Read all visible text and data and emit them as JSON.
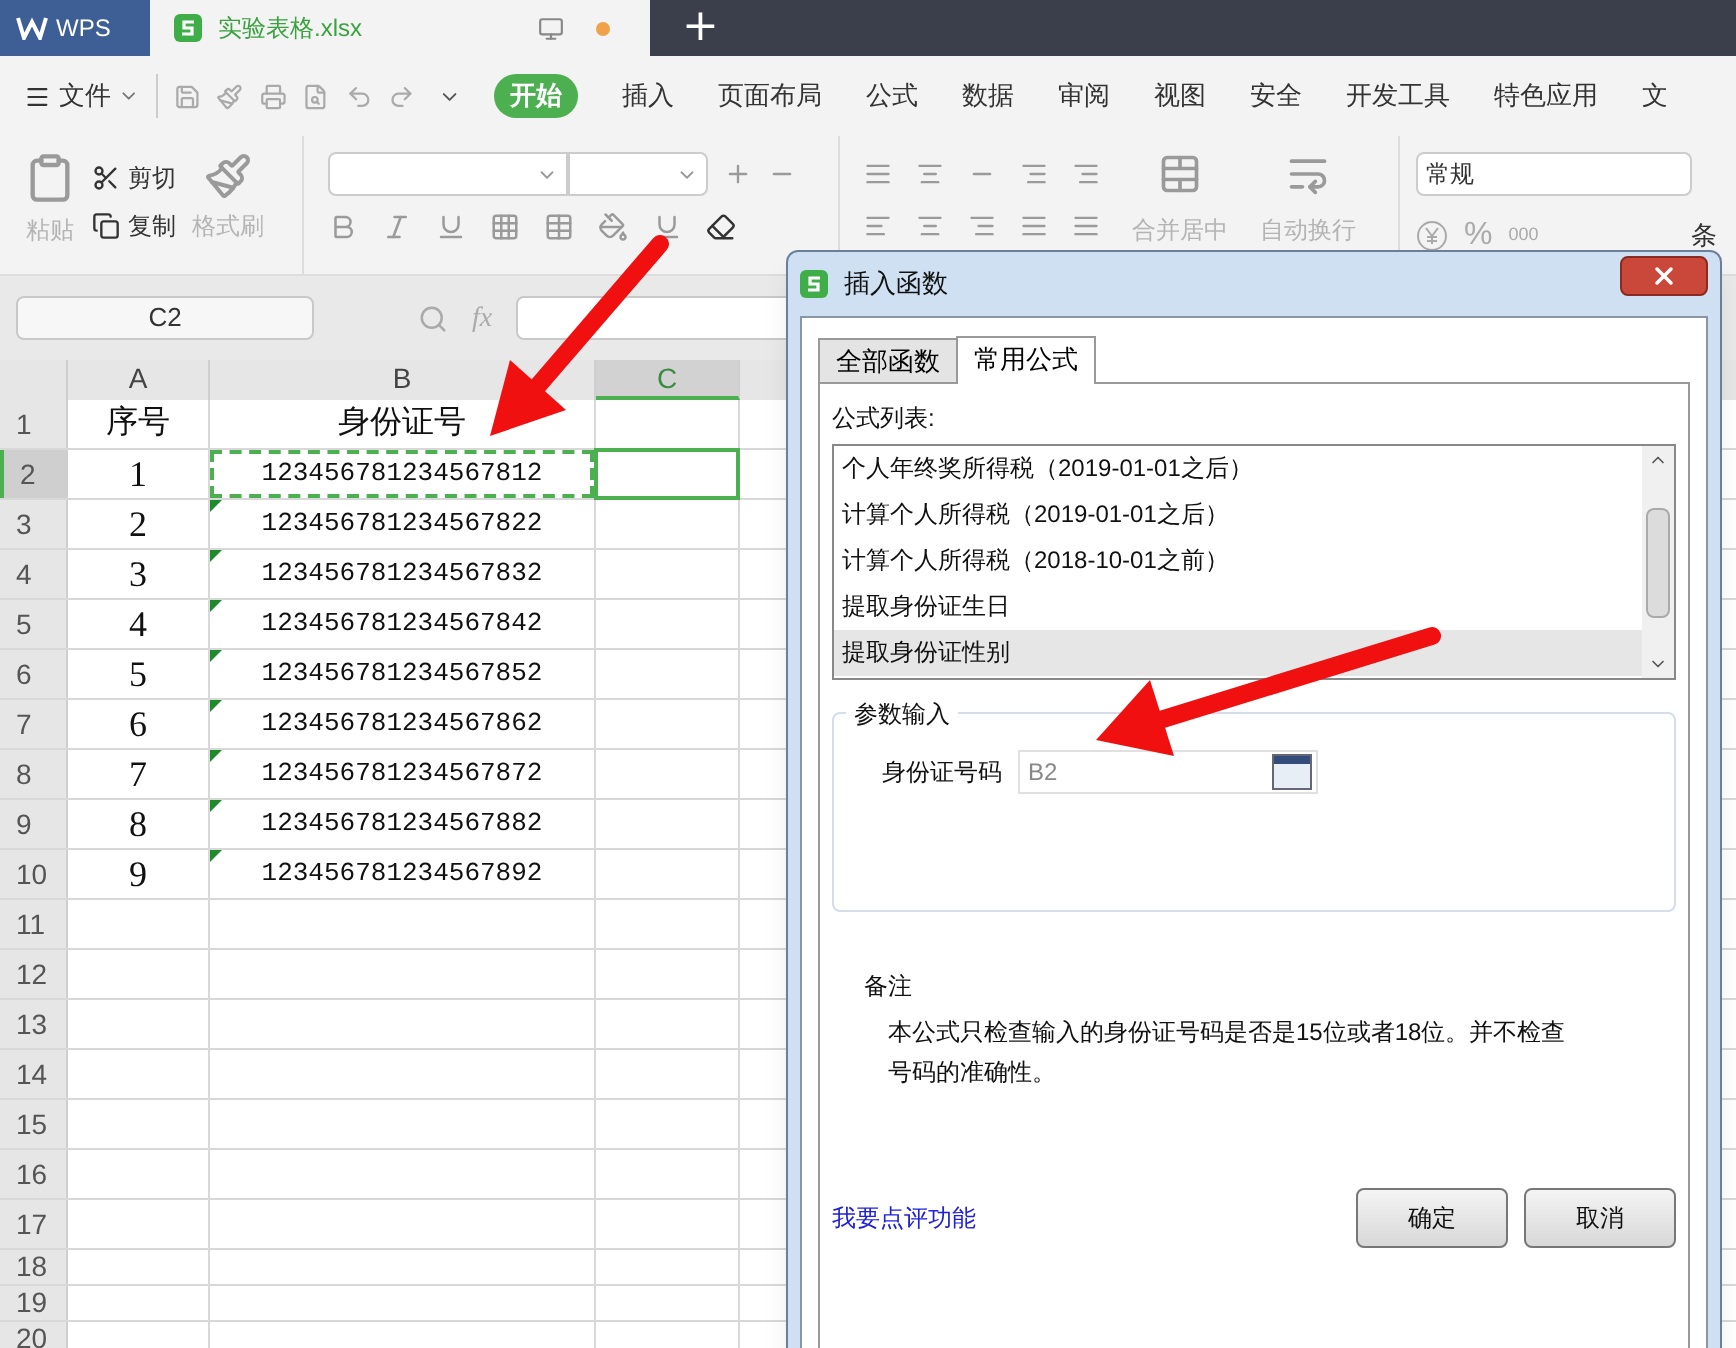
{
  "app_tabs": [
    {
      "kind": "home",
      "label": "WPS",
      "selected": false
    },
    {
      "kind": "file",
      "label": "实验表格.xlsx",
      "selected": true,
      "unsaved": true
    }
  ],
  "new_tab": "+",
  "menu": {
    "file": "文件",
    "items": [
      {
        "label": "开始",
        "selected": true
      },
      {
        "label": "插入",
        "selected": false
      },
      {
        "label": "页面布局",
        "selected": false
      },
      {
        "label": "公式",
        "selected": false
      },
      {
        "label": "数据",
        "selected": false
      },
      {
        "label": "审阅",
        "selected": false
      },
      {
        "label": "视图",
        "selected": false
      },
      {
        "label": "安全",
        "selected": false
      },
      {
        "label": "开发工具",
        "selected": false
      },
      {
        "label": "特色应用",
        "selected": false
      },
      {
        "label": "文",
        "selected": false
      }
    ]
  },
  "ribbon": {
    "paste": {
      "label": "粘贴",
      "disabled": true
    },
    "cut": {
      "label": "剪切",
      "disabled": false
    },
    "copy": {
      "label": "复制",
      "disabled": false
    },
    "format_painter": {
      "label": "格式刷",
      "disabled": true
    },
    "merge": {
      "label": "合并居中",
      "disabled": true
    },
    "wrap": {
      "label": "自动换行",
      "disabled": true
    },
    "number_format": "常规",
    "percent": "%",
    "thousands": "000",
    "cut_edge": "条"
  },
  "formula_bar": {
    "name_box": "C2",
    "fx": "fx"
  },
  "sheet": {
    "columns": [
      {
        "label": "A",
        "selected": false
      },
      {
        "label": "B",
        "selected": false
      },
      {
        "label": "C",
        "selected": true
      }
    ],
    "rows": [
      {
        "label": "1",
        "selected": false,
        "cells": [
          {
            "text": "序号",
            "flagged": false,
            "copied": false
          },
          {
            "text": "身份证号",
            "flagged": false,
            "copied": false
          }
        ]
      },
      {
        "label": "2",
        "selected": true,
        "cells": [
          {
            "text": "1",
            "flagged": false,
            "copied": false
          },
          {
            "text": "123456781234567812",
            "flagged": false,
            "copied": true
          }
        ]
      },
      {
        "label": "3",
        "selected": false,
        "cells": [
          {
            "text": "2",
            "flagged": false,
            "copied": false
          },
          {
            "text": "123456781234567822",
            "flagged": true,
            "copied": false
          }
        ]
      },
      {
        "label": "4",
        "selected": false,
        "cells": [
          {
            "text": "3",
            "flagged": false,
            "copied": false
          },
          {
            "text": "123456781234567832",
            "flagged": true,
            "copied": false
          }
        ]
      },
      {
        "label": "5",
        "selected": false,
        "cells": [
          {
            "text": "4",
            "flagged": false,
            "copied": false
          },
          {
            "text": "123456781234567842",
            "flagged": true,
            "copied": false
          }
        ]
      },
      {
        "label": "6",
        "selected": false,
        "cells": [
          {
            "text": "5",
            "flagged": false,
            "copied": false
          },
          {
            "text": "123456781234567852",
            "flagged": true,
            "copied": false
          }
        ]
      },
      {
        "label": "7",
        "selected": false,
        "cells": [
          {
            "text": "6",
            "flagged": false,
            "copied": false
          },
          {
            "text": "123456781234567862",
            "flagged": true,
            "copied": false
          }
        ]
      },
      {
        "label": "8",
        "selected": false,
        "cells": [
          {
            "text": "7",
            "flagged": false,
            "copied": false
          },
          {
            "text": "123456781234567872",
            "flagged": true,
            "copied": false
          }
        ]
      },
      {
        "label": "9",
        "selected": false,
        "cells": [
          {
            "text": "8",
            "flagged": false,
            "copied": false
          },
          {
            "text": "123456781234567882",
            "flagged": true,
            "copied": false
          }
        ]
      },
      {
        "label": "10",
        "selected": false,
        "cells": [
          {
            "text": "9",
            "flagged": false,
            "copied": false
          },
          {
            "text": "123456781234567892",
            "flagged": true,
            "copied": false
          }
        ]
      },
      {
        "label": "11",
        "selected": false
      },
      {
        "label": "12",
        "selected": false
      },
      {
        "label": "13",
        "selected": false
      },
      {
        "label": "14",
        "selected": false
      },
      {
        "label": "15",
        "selected": false
      },
      {
        "label": "16",
        "selected": false
      },
      {
        "label": "17",
        "selected": false
      },
      {
        "label": "18",
        "selected": false
      },
      {
        "label": "19",
        "selected": false
      },
      {
        "label": "20",
        "selected": false
      }
    ]
  },
  "dialog": {
    "title": "插入函数",
    "tabs": [
      {
        "label": "全部函数",
        "selected": false
      },
      {
        "label": "常用公式",
        "selected": true
      }
    ],
    "list_label": "公式列表:",
    "formulas": [
      {
        "label": "个人年终奖所得税（2019-01-01之后）",
        "selected": false
      },
      {
        "label": "计算个人所得税（2019-01-01之后）",
        "selected": false
      },
      {
        "label": "计算个人所得税（2018-10-01之前）",
        "selected": false
      },
      {
        "label": "提取身份证生日",
        "selected": false
      },
      {
        "label": "提取身份证性别",
        "selected": true
      }
    ],
    "params_title": "参数输入",
    "param": {
      "label": "身份证号码",
      "value": "B2"
    },
    "notes_title": "备注",
    "notes": "本公式只检查输入的身份证号码是否是15位或者18位。并不检查号码的准确性。",
    "link": "我要点评功能",
    "buttons": [
      "确定",
      "取消"
    ]
  }
}
